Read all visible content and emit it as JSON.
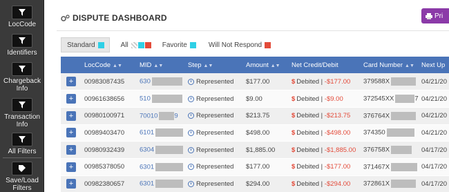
{
  "rail": {
    "items": [
      {
        "label": "LocCode"
      },
      {
        "label": "Identifiers"
      },
      {
        "label": "Chargeback Info"
      },
      {
        "label": "Transaction Info"
      },
      {
        "label": "All Filters"
      },
      {
        "label": "Save/Load Filters"
      }
    ]
  },
  "header": {
    "title": "DISPUTE DASHBOARD",
    "print_label": "Pri"
  },
  "filters": [
    {
      "label": "Standard",
      "active": true
    },
    {
      "label": "All"
    },
    {
      "label": "Favorite"
    },
    {
      "label": "Will Not Respond"
    }
  ],
  "table": {
    "columns": [
      "LocCode",
      "MID",
      "Step",
      "Amount",
      "Net Credit/Debit",
      "Card Number",
      "Next Up"
    ],
    "rows": [
      {
        "loccode": "00983087435",
        "mid": "630",
        "step": "Represented",
        "amount": "$177.00",
        "net_prefix": "Debited |",
        "net_value": "-$177.00",
        "card": "379588X",
        "next": "04/21/20"
      },
      {
        "loccode": "00961638656",
        "mid": "510",
        "step": "Represented",
        "amount": "$9.00",
        "net_prefix": "Debited |",
        "net_value": "-$9.00",
        "card": "372545XX",
        "card_suffix": "7",
        "next": "04/21/20"
      },
      {
        "loccode": "00980100971",
        "mid": "70010",
        "mid_suffix": "9",
        "step": "Represented",
        "amount": "$213.75",
        "net_prefix": "Debited |",
        "net_value": "-$213.75",
        "card": "376764X",
        "next": "04/21/20"
      },
      {
        "loccode": "00989403470",
        "mid": "6101",
        "step": "Represented",
        "amount": "$498.00",
        "net_prefix": "Debited |",
        "net_value": "-$498.00",
        "card": "374350",
        "next": "04/21/20"
      },
      {
        "loccode": "00980932439",
        "mid": "6304",
        "step": "Represented",
        "amount": "$1,885.00",
        "net_prefix": "Debited |",
        "net_value": "-$1,885.00",
        "card": "376758X",
        "next": "04/17/20"
      },
      {
        "loccode": "00985378050",
        "mid": "6301",
        "step": "Represented",
        "amount": "$177.00",
        "net_prefix": "Debited |",
        "net_value": "-$177.00",
        "card": "371467X",
        "next": "04/17/20"
      },
      {
        "loccode": "00982380657",
        "mid": "6301",
        "step": "Represented",
        "amount": "$294.00",
        "net_prefix": "Debited |",
        "net_value": "-$294.00",
        "card": "372861X",
        "next": "04/17/20"
      }
    ]
  }
}
